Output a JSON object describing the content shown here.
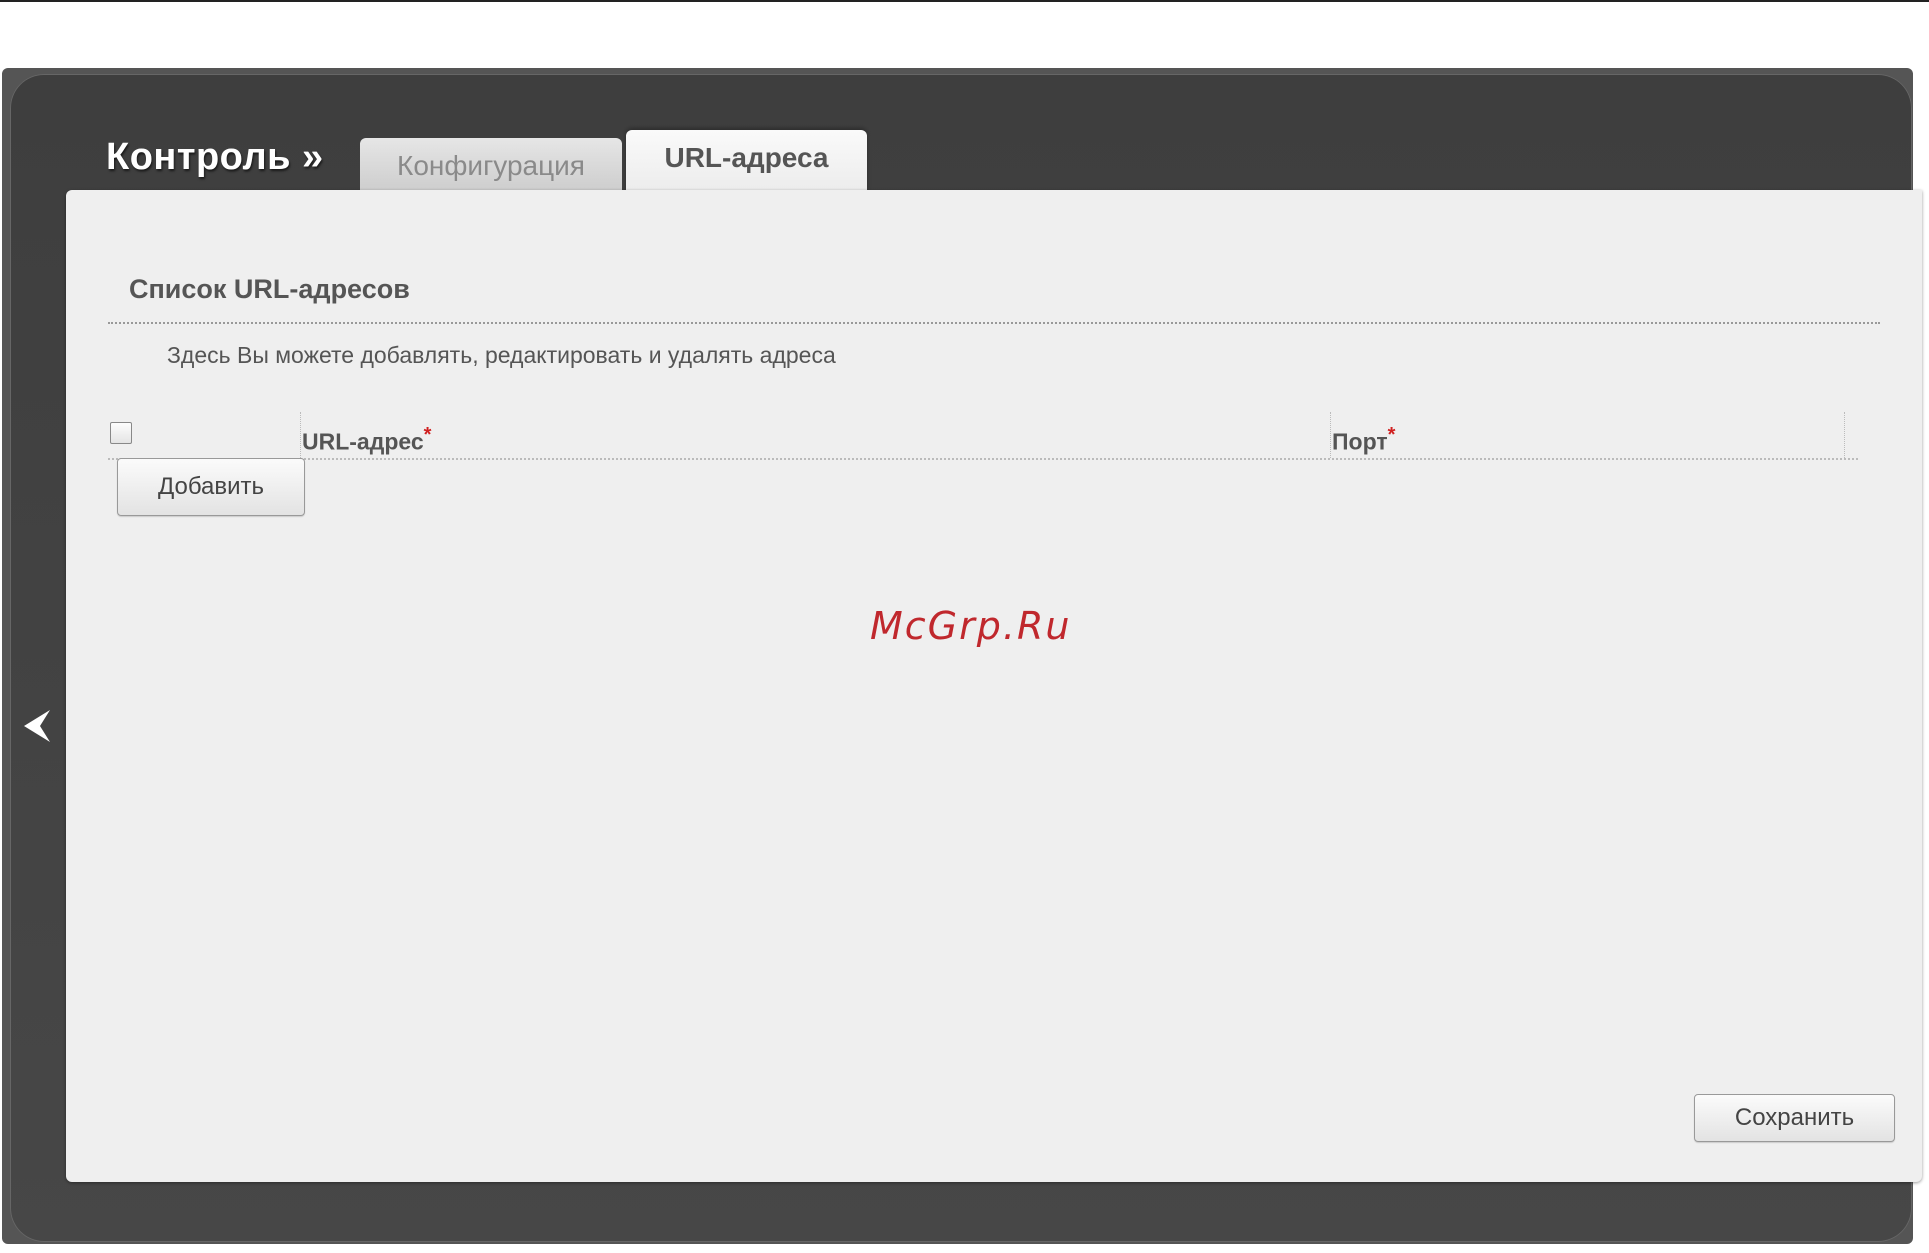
{
  "section": {
    "title": "Контроль »"
  },
  "tabs": [
    {
      "label": "Конфигурация",
      "active": false
    },
    {
      "label": "URL-адреса",
      "active": true
    }
  ],
  "panel": {
    "heading": "Список URL-адресов",
    "description": "Здесь Вы можете добавлять, редактировать и удалять адреса"
  },
  "table": {
    "columns": [
      {
        "label": "URL-адрес",
        "required_mark": "*"
      },
      {
        "label": "Порт",
        "required_mark": "*"
      }
    ],
    "rows": []
  },
  "buttons": {
    "add_label": "Добавить",
    "save_label": "Сохранить"
  },
  "watermark": "McGrp.Ru",
  "icons": {
    "back": "chevron-left-icon"
  },
  "colors": {
    "shell": "#444444",
    "panel": "#efefef",
    "required": "#d02020",
    "watermark": "#c0282d"
  }
}
